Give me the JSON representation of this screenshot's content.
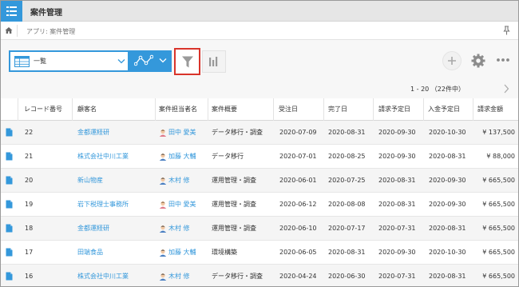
{
  "app": {
    "title": "案件管理"
  },
  "breadcrumb": {
    "text": "アプリ: 案件管理"
  },
  "toolbar": {
    "view_label": "一覧",
    "pager_text": "1 - 20 （22件中）"
  },
  "colors": {
    "accent": "#3498db",
    "filter_highlight": "#d9342b",
    "link": "#3498db"
  },
  "icons": [
    "app-list-icon",
    "home-icon",
    "pin-icon",
    "table-view-icon",
    "chevron-down-icon",
    "graph-icon",
    "filter-icon",
    "bar-chart-icon",
    "plus-icon",
    "gear-icon",
    "more-icon",
    "chevron-right-icon",
    "document-icon",
    "user-icon"
  ],
  "table": {
    "headers": [
      "レコード番号",
      "顧客名",
      "案件担当者名",
      "案件概要",
      "受注日",
      "完了日",
      "請求予定日",
      "入金予定日",
      "請求金額"
    ],
    "rows": [
      {
        "id": "22",
        "customer": "金都運経研",
        "user_icon": "female",
        "assignee": "田中 愛美",
        "summary": "データ移行・調査",
        "order_date": "2020-07-09",
        "done_date": "2020-08-31",
        "bill_date": "2020-09-30",
        "pay_date": "2020-10-30",
        "amount": "¥ 137,500"
      },
      {
        "id": "21",
        "customer": "株式会社中川工業",
        "user_icon": "male",
        "assignee": "加藤 大輔",
        "summary": "データ移行",
        "order_date": "2020-07-01",
        "done_date": "2020-08-25",
        "bill_date": "2020-09-30",
        "pay_date": "2020-08-31",
        "amount": "¥ 88,000"
      },
      {
        "id": "20",
        "customer": "新山物産",
        "user_icon": "male",
        "assignee": "木村 修",
        "summary": "運用管理・調査",
        "order_date": "2020-06-01",
        "done_date": "2020-07-25",
        "bill_date": "2020-08-31",
        "pay_date": "2020-09-30",
        "amount": "¥ 665,500"
      },
      {
        "id": "19",
        "customer": "岩下税理士事務所",
        "user_icon": "female",
        "assignee": "田中 愛美",
        "summary": "運用管理・調査",
        "order_date": "2020-06-12",
        "done_date": "2020-08-08",
        "bill_date": "2020-08-31",
        "pay_date": "2020-09-30",
        "amount": "¥ 665,500"
      },
      {
        "id": "18",
        "customer": "金都運経研",
        "user_icon": "male",
        "assignee": "木村 修",
        "summary": "運用管理・調査",
        "order_date": "2020-06-10",
        "done_date": "2020-07-17",
        "bill_date": "2020-07-31",
        "pay_date": "2020-08-31",
        "amount": "¥ 665,500"
      },
      {
        "id": "17",
        "customer": "田端食品",
        "user_icon": "male",
        "assignee": "加藤 大輔",
        "summary": "環境構築",
        "order_date": "2020-06-05",
        "done_date": "2020-08-31",
        "bill_date": "2020-09-30",
        "pay_date": "2020-10-30",
        "amount": "¥ 665,500"
      },
      {
        "id": "16",
        "customer": "株式会社中川工業",
        "user_icon": "male",
        "assignee": "木村 修",
        "summary": "データ移行・調査",
        "order_date": "2020-04-24",
        "done_date": "2020-06-30",
        "bill_date": "2020-07-31",
        "pay_date": "2020-08-31",
        "amount": "¥ 665,500"
      }
    ]
  }
}
